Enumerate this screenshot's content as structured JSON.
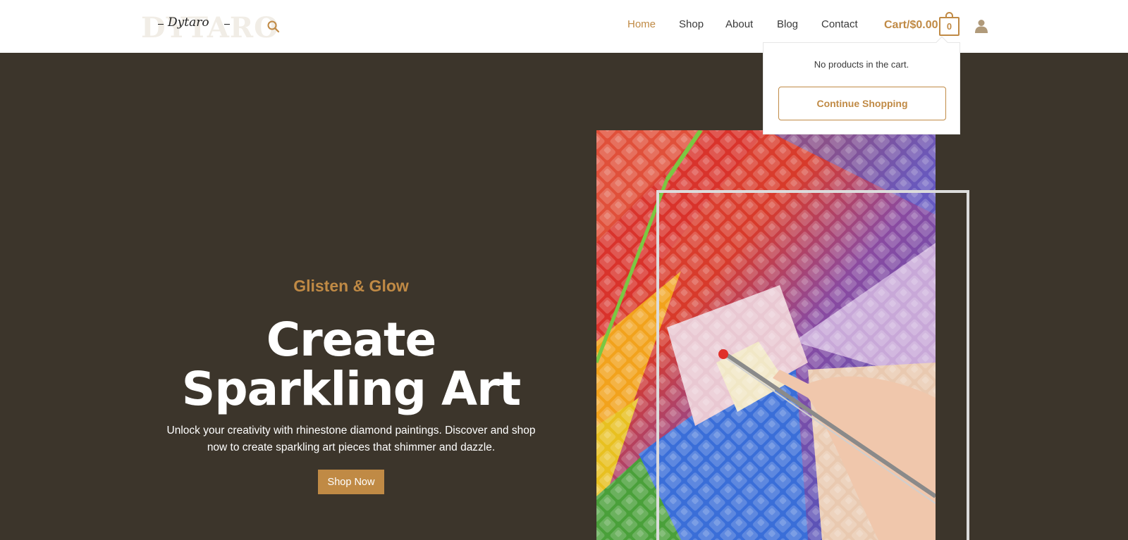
{
  "brand": {
    "logo_bg_text": "DYTARO",
    "logo_script_text": "Dytaro"
  },
  "nav": {
    "items": [
      "Home",
      "Shop",
      "About",
      "Blog",
      "Contact"
    ],
    "active": "Home"
  },
  "cart": {
    "label": "Cart/$0.00",
    "count": "0",
    "empty_message": "No products in the cart.",
    "continue_label": "Continue Shopping"
  },
  "hero": {
    "eyebrow": "Glisten & Glow",
    "title_line1": "Create",
    "title_line2": "Sparkling Art",
    "subtitle": "Unlock your creativity with rhinestone diamond paintings. Discover and shop now to create sparkling art pieces that shimmer and dazzle.",
    "cta_label": "Shop Now"
  },
  "colors": {
    "accent": "#c08a45",
    "hero_bg": "#3c352b",
    "header_bg": "#ffffff",
    "nav_text": "#3a3a3a"
  },
  "icons": [
    "search-icon",
    "cart-bag-icon",
    "user-icon"
  ]
}
